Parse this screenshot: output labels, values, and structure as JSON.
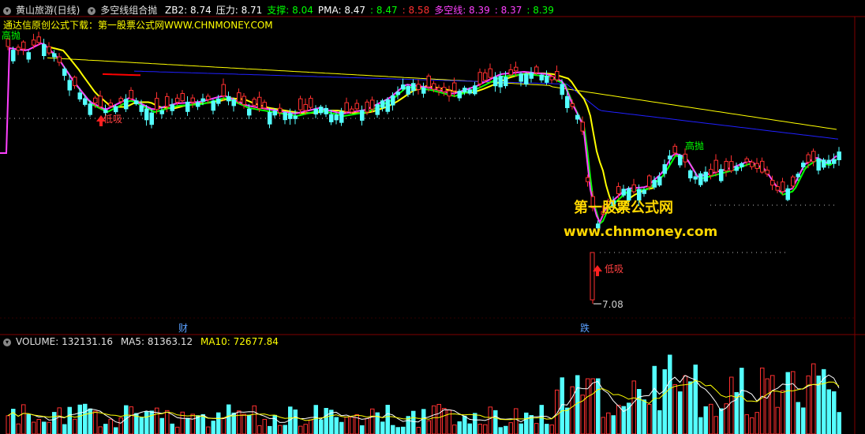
{
  "header": {
    "stock": "黄山旅游(日线)",
    "indicator": "多空线组合抛",
    "items": [
      {
        "label": "ZB2:",
        "value": "8.74",
        "color": "#ffffff"
      },
      {
        "label": "压力:",
        "value": "8.71",
        "color": "#ffffff"
      },
      {
        "label": "支撑:",
        "value": "8.04",
        "color": "#00ff00"
      },
      {
        "label": "PMA:",
        "value": "8.47",
        "color": "#ffffff"
      },
      {
        "label": ":",
        "value": "8.47",
        "color": "#00ff00"
      },
      {
        "label": ":",
        "value": "8.58",
        "color": "#ff3030"
      },
      {
        "label": "多空线:",
        "value": "8.39",
        "color": "#ff40ff"
      },
      {
        "label": ":",
        "value": "8.37",
        "color": "#ff40ff"
      },
      {
        "label": ":",
        "value": "8.39",
        "color": "#00ff00"
      }
    ],
    "notice": "通达信原创公式下载：第一股票公式网WWW.CHNMONEY.COM"
  },
  "chart_data": {
    "type": "candlestick",
    "price_annotations": {
      "low_buy_1": "低吸",
      "low_buy_2": "低吸",
      "high_sell": "高抛",
      "low_price": "7.08",
      "top_left": "高抛"
    },
    "event_markers": [
      "财",
      "跌"
    ],
    "watermark": {
      "line1": "第一股票公式网",
      "line2": "www.chnmoney.com"
    },
    "volume_header": {
      "label": "VOLUME: 132131.16",
      "ma5": "MA5: 81363.12",
      "ma10": "MA10: 72677.84"
    }
  },
  "colors": {
    "up": "#ff3030",
    "down": "#54ffff",
    "ma_yellow": "#ffff00",
    "ma_blue": "#2020ff",
    "ma_red": "#ff0000",
    "ma_magenta": "#ff40ff",
    "ma_green": "#00ff00",
    "grid": "#800000"
  }
}
